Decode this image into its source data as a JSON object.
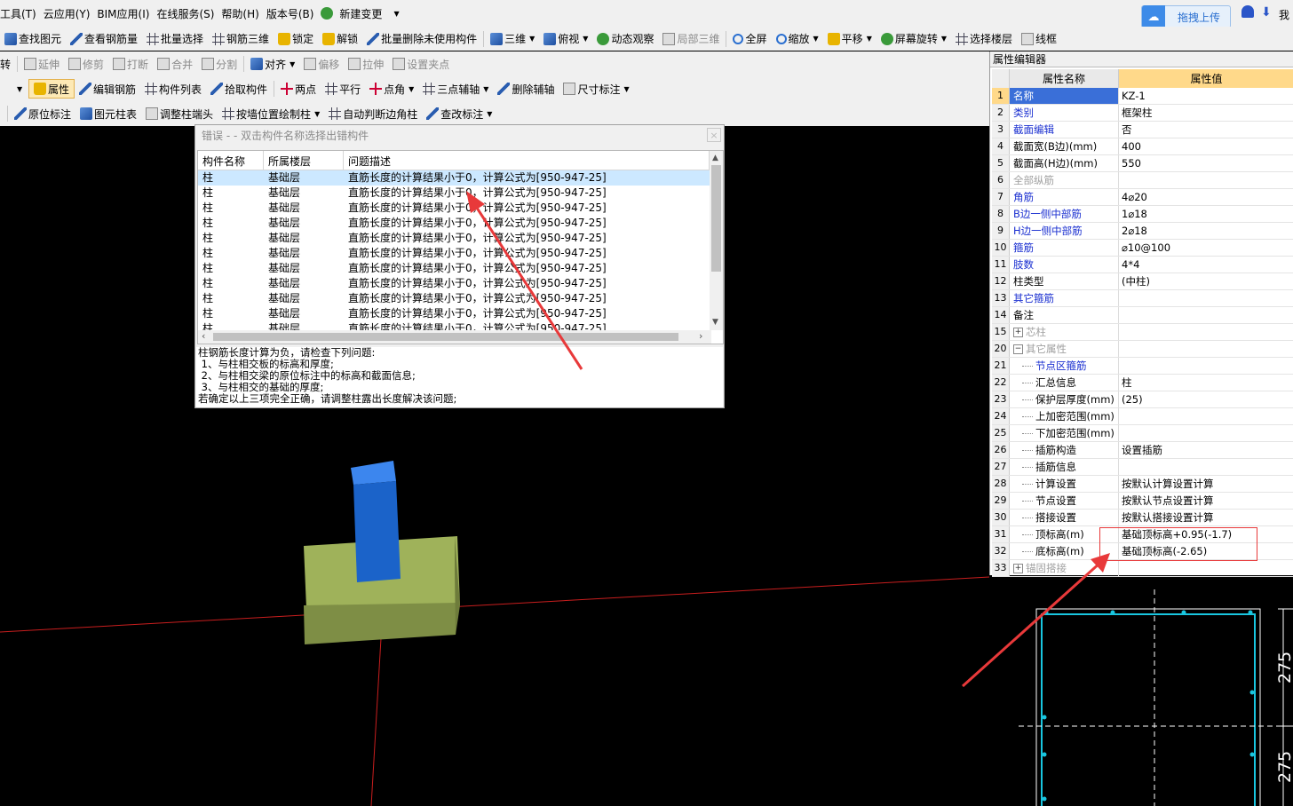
{
  "menu": [
    "工具(T)",
    "云应用(Y)",
    "BIM应用(I)",
    "在线服务(S)",
    "帮助(H)",
    "版本号(B)",
    "新建变更"
  ],
  "toolbar1": [
    "查找图元",
    "查看钢筋量",
    "批量选择",
    "钢筋三维",
    "锁定",
    "解锁",
    "批量删除未使用构件",
    "三维",
    "俯视",
    "动态观察",
    "局部三维",
    "全屏",
    "缩放",
    "平移",
    "屏幕旋转",
    "选择楼层",
    "线框"
  ],
  "toolbar2": [
    "转",
    "延伸",
    "修剪",
    "打断",
    "合并",
    "分割",
    "对齐",
    "偏移",
    "拉伸",
    "设置夹点"
  ],
  "toolbar3": [
    "属性",
    "编辑钢筋",
    "构件列表",
    "拾取构件",
    "两点",
    "平行",
    "点角",
    "三点辅轴",
    "删除辅轴",
    "尺寸标注"
  ],
  "toolbar4": [
    "原位标注",
    "图元柱表",
    "调整柱端头",
    "按墙位置绘制柱",
    "自动判断边角柱",
    "查改标注"
  ],
  "upload": {
    "label": "拖拽上传"
  },
  "top_right_text": "我",
  "error_dialog": {
    "title": "错误 - - 双击构件名称选择出错构件",
    "close": "×",
    "columns": [
      "构件名称",
      "所属楼层",
      "问题描述"
    ],
    "rows": [
      [
        "柱",
        "基础层",
        "直筋长度的计算结果小于0，计算公式为[950-947-25]"
      ],
      [
        "柱",
        "基础层",
        "直筋长度的计算结果小于0，计算公式为[950-947-25]"
      ],
      [
        "柱",
        "基础层",
        "直筋长度的计算结果小于0，计算公式为[950-947-25]"
      ],
      [
        "柱",
        "基础层",
        "直筋长度的计算结果小于0，计算公式为[950-947-25]"
      ],
      [
        "柱",
        "基础层",
        "直筋长度的计算结果小于0，计算公式为[950-947-25]"
      ],
      [
        "柱",
        "基础层",
        "直筋长度的计算结果小于0，计算公式为[950-947-25]"
      ],
      [
        "柱",
        "基础层",
        "直筋长度的计算结果小于0，计算公式为[950-947-25]"
      ],
      [
        "柱",
        "基础层",
        "直筋长度的计算结果小于0，计算公式为[950-947-25]"
      ],
      [
        "柱",
        "基础层",
        "直筋长度的计算结果小于0，计算公式为[950-947-25]"
      ],
      [
        "柱",
        "基础层",
        "直筋长度的计算结果小于0，计算公式为[950-947-25]"
      ],
      [
        "柱",
        "基础层",
        "直筋长度的计算结果小于0，计算公式为[950-947-25]"
      ]
    ],
    "message": "柱钢筋长度计算为负，请检查下列问题:\n 1、与柱相交板的标高和厚度;\n 2、与柱相交梁的原位标注中的标高和截面信息;\n 3、与柱相交的基础的厚度;\n若确定以上三项完全正确，请调整柱露出长度解决该问题;"
  },
  "property_editor": {
    "title": "属性编辑器",
    "col_name": "属性名称",
    "col_value": "属性值",
    "rows": [
      {
        "no": "1",
        "name": "名称",
        "value": "KZ-1",
        "style": "blue",
        "selected": true
      },
      {
        "no": "2",
        "name": "类别",
        "value": "框架柱",
        "style": "blue"
      },
      {
        "no": "3",
        "name": "截面编辑",
        "value": "否",
        "style": "blue"
      },
      {
        "no": "4",
        "name": "截面宽(B边)(mm)",
        "value": "400",
        "style": "black"
      },
      {
        "no": "5",
        "name": "截面高(H边)(mm)",
        "value": "550",
        "style": "black"
      },
      {
        "no": "6",
        "name": "全部纵筋",
        "value": "",
        "style": "gray"
      },
      {
        "no": "7",
        "name": "角筋",
        "value": "4⌀20",
        "style": "blue"
      },
      {
        "no": "8",
        "name": "B边一侧中部筋",
        "value": "1⌀18",
        "style": "blue"
      },
      {
        "no": "9",
        "name": "H边一侧中部筋",
        "value": "2⌀18",
        "style": "blue"
      },
      {
        "no": "10",
        "name": "箍筋",
        "value": "⌀10@100",
        "style": "blue"
      },
      {
        "no": "11",
        "name": "肢数",
        "value": "4*4",
        "style": "blue"
      },
      {
        "no": "12",
        "name": "柱类型",
        "value": "(中柱)",
        "style": "black"
      },
      {
        "no": "13",
        "name": "其它箍筋",
        "value": "",
        "style": "blue"
      },
      {
        "no": "14",
        "name": "备注",
        "value": "",
        "style": "black"
      },
      {
        "no": "15",
        "name": "芯柱",
        "value": "",
        "style": "gray",
        "expander": "+"
      },
      {
        "no": "20",
        "name": "其它属性",
        "value": "",
        "style": "gray",
        "expander": "−"
      },
      {
        "no": "21",
        "name": "节点区箍筋",
        "value": "",
        "style": "blue",
        "child": true
      },
      {
        "no": "22",
        "name": "汇总信息",
        "value": "柱",
        "style": "black",
        "child": true
      },
      {
        "no": "23",
        "name": "保护层厚度(mm)",
        "value": "(25)",
        "style": "black",
        "child": true
      },
      {
        "no": "24",
        "name": "上加密范围(mm)",
        "value": "",
        "style": "black",
        "child": true
      },
      {
        "no": "25",
        "name": "下加密范围(mm)",
        "value": "",
        "style": "black",
        "child": true
      },
      {
        "no": "26",
        "name": "插筋构造",
        "value": "设置插筋",
        "style": "black",
        "child": true
      },
      {
        "no": "27",
        "name": "插筋信息",
        "value": "",
        "style": "black",
        "child": true
      },
      {
        "no": "28",
        "name": "计算设置",
        "value": "按默认计算设置计算",
        "style": "black",
        "child": true
      },
      {
        "no": "29",
        "name": "节点设置",
        "value": "按默认节点设置计算",
        "style": "black",
        "child": true
      },
      {
        "no": "30",
        "name": "搭接设置",
        "value": "按默认搭接设置计算",
        "style": "black",
        "child": true
      },
      {
        "no": "31",
        "name": "顶标高(m)",
        "value": "基础顶标高+0.95(-1.7)",
        "style": "black",
        "child": true
      },
      {
        "no": "32",
        "name": "底标高(m)",
        "value": "基础顶标高(-2.65)",
        "style": "black",
        "child": true
      },
      {
        "no": "33",
        "name": "锚固搭接",
        "value": "",
        "style": "gray",
        "expander": "+"
      }
    ]
  },
  "section_view": {
    "dim_top": "275",
    "dim_bottom": "275"
  },
  "colors": {
    "annotation": "#e8393a",
    "column": "#1b63c9",
    "footing": "#9fb25a",
    "section": "#19c6e0"
  }
}
